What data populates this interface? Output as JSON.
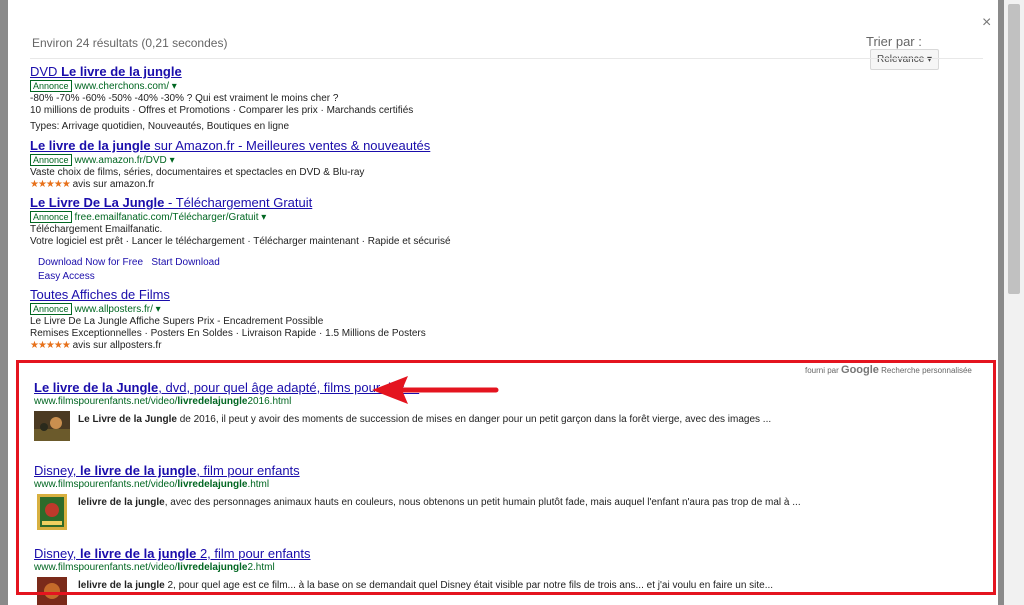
{
  "header": {
    "count": "Environ 24 résultats (0,21 secondes)",
    "sort_label": "Trier par :",
    "sort_value": "Relevance",
    "close": "×"
  },
  "ads": [
    {
      "title_1": "DVD ",
      "title_2": "Le livre de la jungle",
      "title_3": "",
      "url": "www.cherchons.com/",
      "lines": [
        "-80% -70% -60% -50% -40% -30% ? Qui est vraiment le moins cher ?",
        "10 millions de produits · Offres et Promotions · Comparer les prix · Marchands certifiés"
      ],
      "extra": "Types: Arrivage quotidien, Nouveautés, Boutiques en ligne"
    },
    {
      "title_1": "",
      "title_2": "Le livre de la jungle",
      "title_3": " sur Amazon.fr - Meilleures ventes & nouveautés",
      "url": "www.amazon.fr/DVD",
      "lines": [
        "Vaste choix de films, séries, documentaires et spectacles en DVD & Blu-ray"
      ],
      "stars": "★★★★★",
      "rating": "avis sur amazon.fr"
    },
    {
      "title_1": "",
      "title_2": "Le Livre De La Jungle",
      "title_3": " - Téléchargement Gratuit",
      "url": "free.emailfanatic.com/Télécharger/Gratuit",
      "lines": [
        "Téléchargement Emailfanatic.",
        "Votre logiciel est prêt · Lancer le téléchargement · Télécharger maintenant · Rapide et sécurisé"
      ],
      "sublinks": [
        "Download Now for Free",
        "Start Download",
        "Easy Access"
      ]
    },
    {
      "title_1": "Toutes Affiches de Films",
      "title_2": "",
      "title_3": "",
      "url": "www.allposters.fr/",
      "lines": [
        "Le Livre De La Jungle Affiche Supers Prix - Encadrement Possible",
        "Remises Exceptionnelles · Posters En Soldes · Livraison Rapide · 1.5 Millions de Posters"
      ],
      "stars": "★★★★★",
      "rating": "avis sur allposters.fr"
    }
  ],
  "badge": "Annonce",
  "powered": {
    "by": "fourni par",
    "brand": "Google",
    "label": "Recherche personnalisée"
  },
  "results": [
    {
      "title_a": "Le livre de la Jungle",
      "title_b": ", dvd, pour quel âge adapté, films pour des ...",
      "url_a": "www.filmspourenfants.net/video/",
      "url_b": "livredelajungle",
      "url_c": "2016.html",
      "snip_a": "Le Livre de la Jungle",
      "snip_b": " de 2016, il peut y avoir des moments de succession de mises en danger pour un petit garçon dans la forêt vierge, avec des images ..."
    },
    {
      "title_a": "Disney, ",
      "title_b": "le livre de la jungle",
      "title_c": ", film pour enfants",
      "url_a": "www.filmspourenfants.net/video/",
      "url_b": "livredelajungle",
      "url_c": ".html",
      "snip_a": "lelivre de la jungle",
      "snip_b": ", avec des personnages animaux hauts en couleurs, nous obtenons un petit humain plutôt fade, mais auquel l'enfant n'aura pas trop de mal à ..."
    },
    {
      "title_a": "Disney, ",
      "title_b": "le livre de la jungle",
      "title_c": " 2, film pour enfants",
      "url_a": "www.filmspourenfants.net/video/",
      "url_b": "livredelajungle",
      "url_c": "2.html",
      "snip_a": "lelivre de la jungle",
      "snip_b": " 2, pour quel age est ce film... à la base on se demandait quel Disney était visible par notre fils de trois ans... et j'ai voulu en faire un site..."
    }
  ],
  "colors": {
    "link": "#1a0dab",
    "url": "#006621",
    "highlight": "#e4141f",
    "stars": "#e7711b"
  }
}
